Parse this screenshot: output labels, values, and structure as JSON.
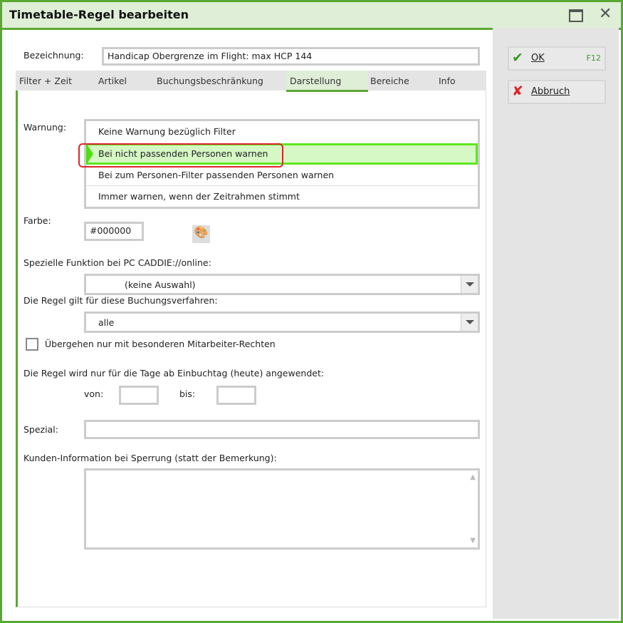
{
  "window": {
    "title": "Timetable-Regel bearbeiten"
  },
  "buttons": {
    "ok": "OK",
    "ok_key": "F12",
    "cancel": "Abbruch"
  },
  "bezeichnung": {
    "label": "Bezeichnung:",
    "value": "Handicap Obergrenze im Flight: max HCP 144"
  },
  "tabs": [
    "Filter + Zeit",
    "Artikel",
    "Buchungsbeschränkung",
    "Darstellung",
    "Bereiche",
    "Info"
  ],
  "active_tab": "Darstellung",
  "warnung": {
    "label": "Warnung:",
    "options": [
      "Keine Warnung bezüglich Filter",
      "Bei nicht passenden Personen warnen",
      "Bei zum Personen-Filter passenden Personen warnen",
      "Immer warnen, wenn der Zeitrahmen stimmt"
    ],
    "selected": "Bei nicht passenden Personen warnen"
  },
  "farbe": {
    "label": "Farbe:",
    "value": "#000000"
  },
  "online": {
    "label": "Spezielle Funktion bei PC CADDIE://online:",
    "value": "(keine Auswahl)"
  },
  "verfahren": {
    "label": "Die Regel gilt für diese Buchungsverfahren:",
    "value": "alle"
  },
  "checkbox": {
    "label": "Übergehen nur mit besonderen Mitarbeiter-Rechten",
    "checked": false
  },
  "tage": {
    "label": "Die Regel wird nur für die Tage ab Einbuchtag (heute) angewendet:",
    "von": "von:",
    "bis": "bis:",
    "von_value": "",
    "bis_value": ""
  },
  "spezial": {
    "label": "Spezial:",
    "value": ""
  },
  "kunden": {
    "label": "Kunden-Information bei Sperrung (statt der Bemerkung):",
    "value": ""
  }
}
